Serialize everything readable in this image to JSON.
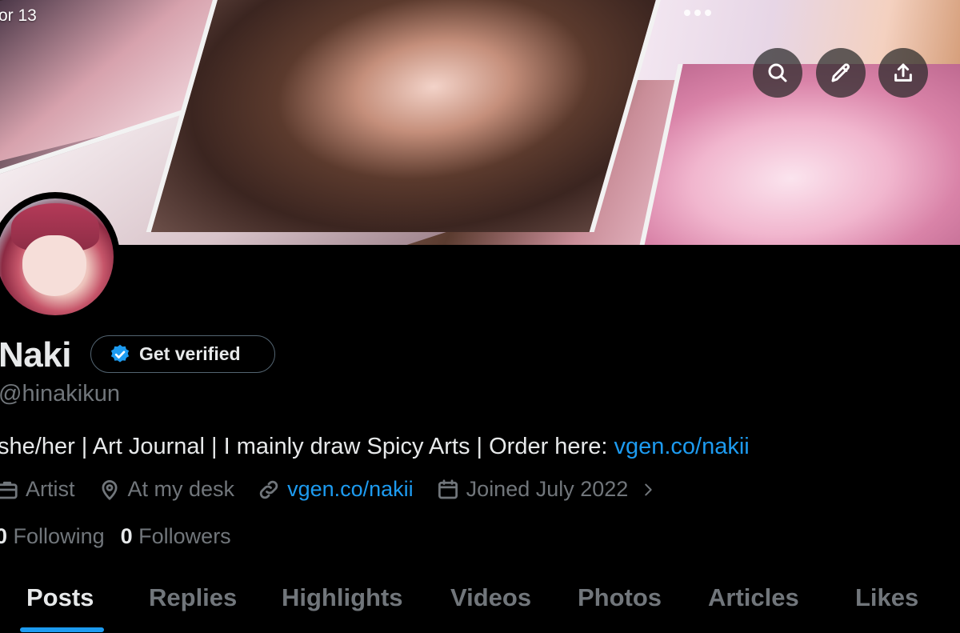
{
  "header": {
    "date_fragment": "or 13",
    "more_icon": "more-dots-icon",
    "buttons": {
      "search_icon": "search-icon",
      "edit_icon": "pencil-icon",
      "share_icon": "share-upload-icon"
    }
  },
  "profile": {
    "name": "Naki",
    "get_verified_label": "Get verified",
    "handle": "@hinakikun",
    "bio_text": "she/her | Art Journal | I mainly draw Spicy Arts | Order here: ",
    "bio_link": "vgen.co/nakii",
    "meta": {
      "profession": "Artist",
      "location": "At my desk",
      "website": "vgen.co/nakii",
      "joined": "Joined July 2022"
    },
    "following_count": "0",
    "following_label": "Following",
    "followers_count": "0",
    "followers_label": "Followers"
  },
  "tabs": [
    {
      "label": "Posts",
      "active": true
    },
    {
      "label": "Replies"
    },
    {
      "label": "Highlights"
    },
    {
      "label": "Videos"
    },
    {
      "label": "Photos"
    },
    {
      "label": "Articles"
    },
    {
      "label": "Likes"
    }
  ],
  "colors": {
    "accent": "#1d9bf0",
    "background": "#000000",
    "muted_text": "#71767b",
    "primary_text": "#e7e9ea"
  }
}
